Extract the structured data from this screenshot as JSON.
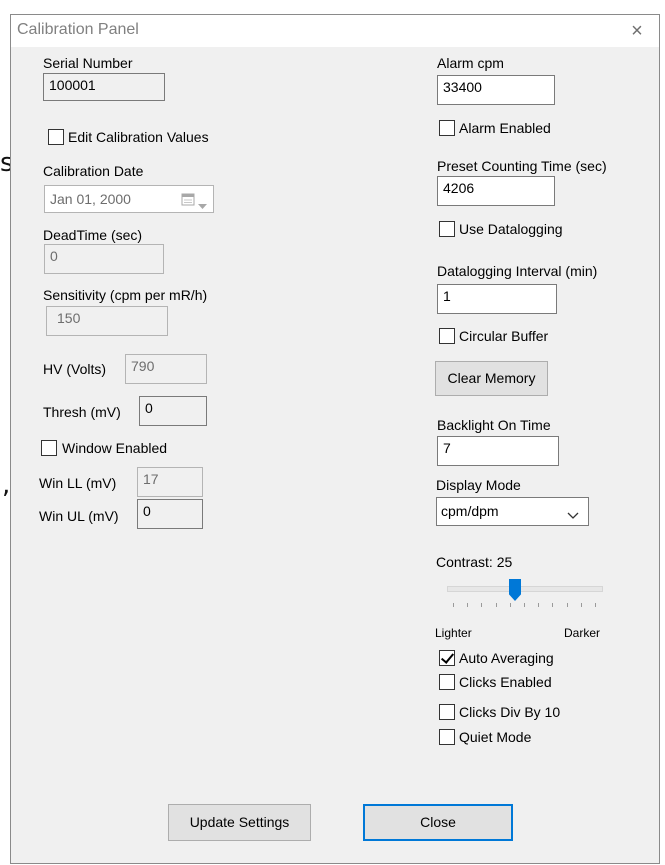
{
  "window": {
    "title": "Calibration Panel",
    "close_glyph": "×"
  },
  "left": {
    "serial_number": {
      "label": "Serial Number",
      "value": "100001"
    },
    "edit_cal": {
      "label": "Edit Calibration Values",
      "checked": false
    },
    "cal_date": {
      "label": "Calibration Date",
      "value": "Jan 01, 2000"
    },
    "dead_time": {
      "label": "DeadTime (sec)",
      "value": "0"
    },
    "sensitivity": {
      "label": "Sensitivity (cpm per mR/h)",
      "value": "150"
    },
    "hv": {
      "label": "HV (Volts)",
      "value": "790"
    },
    "thresh": {
      "label": "Thresh (mV)",
      "value": "0"
    },
    "window_enabled": {
      "label": "Window Enabled",
      "checked": false
    },
    "win_ll": {
      "label": "Win LL (mV)",
      "value": "17"
    },
    "win_ul": {
      "label": "Win UL (mV)",
      "value": "0"
    }
  },
  "right": {
    "alarm_cpm": {
      "label": "Alarm cpm",
      "value": "33400"
    },
    "alarm_enabled": {
      "label": "Alarm Enabled",
      "checked": false
    },
    "preset_time": {
      "label": "Preset Counting Time (sec)",
      "value": "4206"
    },
    "use_datalogging": {
      "label": "Use Datalogging",
      "checked": false
    },
    "datalog_interval": {
      "label": "Datalogging Interval (min)",
      "value": "1"
    },
    "circular_buffer": {
      "label": "Circular Buffer",
      "checked": false
    },
    "clear_memory": {
      "label": "Clear Memory"
    },
    "backlight": {
      "label": "Backlight On Time",
      "value": "7"
    },
    "display_mode": {
      "label": "Display Mode",
      "value": "cpm/dpm"
    },
    "contrast": {
      "label": "Contrast: 25",
      "value": 25,
      "min": 0,
      "max": 100,
      "lighter": "Lighter",
      "darker": "Darker"
    },
    "auto_averaging": {
      "label": "Auto Averaging",
      "checked": true
    },
    "clicks_enabled": {
      "label": "Clicks Enabled",
      "checked": false
    },
    "clicks_div10": {
      "label": "Clicks Div By 10",
      "checked": false
    },
    "quiet_mode": {
      "label": "Quiet Mode",
      "checked": false
    }
  },
  "footer": {
    "update_label": "Update Settings",
    "close_label": "Close"
  },
  "background": {
    "glyph1": "s",
    "glyph2": ","
  },
  "icons": {
    "calendar": "calendar-icon",
    "dropdown": "chevron-down-icon",
    "close": "close-icon"
  },
  "colors": {
    "accent": "#0078d7",
    "dialog_bg": "#f0f0f0",
    "disabled_text": "#6d6d6d"
  }
}
